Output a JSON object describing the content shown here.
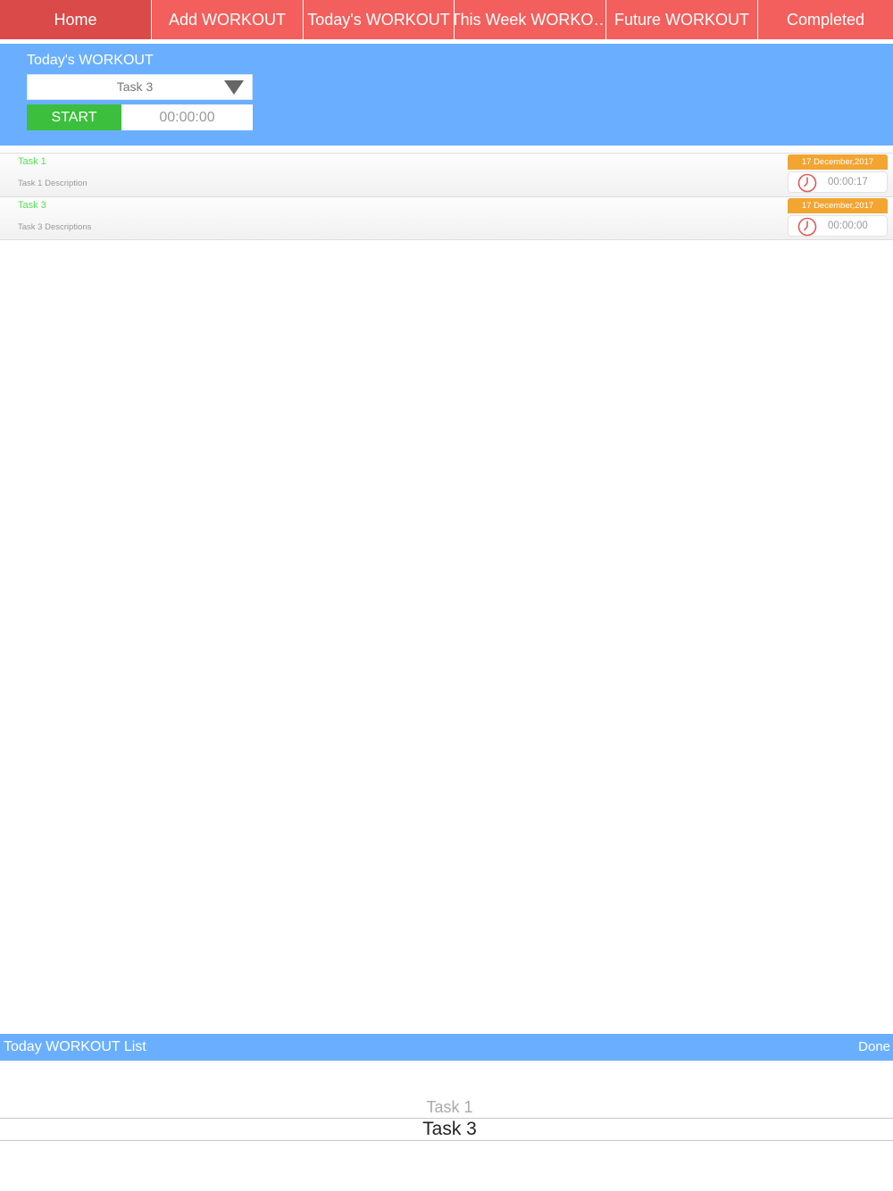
{
  "tabs": [
    {
      "label": "Home",
      "active": true
    },
    {
      "label": "Add WORKOUT",
      "active": false
    },
    {
      "label": "Today's WORKOUT",
      "active": false
    },
    {
      "label": "This Week WORKO…",
      "active": false
    },
    {
      "label": "Future WORKOUT",
      "active": false
    },
    {
      "label": "Completed",
      "active": false
    }
  ],
  "header": {
    "title": "Today's WORKOUT",
    "selected_task": "Task 3",
    "start_label": "START",
    "timer": "00:00:00"
  },
  "tasks": [
    {
      "name": "Task 1",
      "description": "Task 1 Description",
      "date": "17 December,2017",
      "time": "00:00:17",
      "icon": "clock-icon"
    },
    {
      "name": "Task 3",
      "description": "Task 3 Descriptions",
      "date": "17 December,2017",
      "time": "00:00:00",
      "icon": "clock-icon"
    }
  ],
  "picker": {
    "title": "Today WORKOUT List",
    "done_label": "Done",
    "options": [
      "Task 1",
      "Task 3"
    ],
    "selected": "Task 3"
  },
  "colors": {
    "tab_bg": "#f25f5c",
    "tab_active_bg": "#d94a49",
    "header_bg": "#6aafff",
    "start_green": "#3cbf3c",
    "task_name_green": "#55e055",
    "date_badge_orange": "#f2a531",
    "clock_red": "#e05a5a"
  }
}
